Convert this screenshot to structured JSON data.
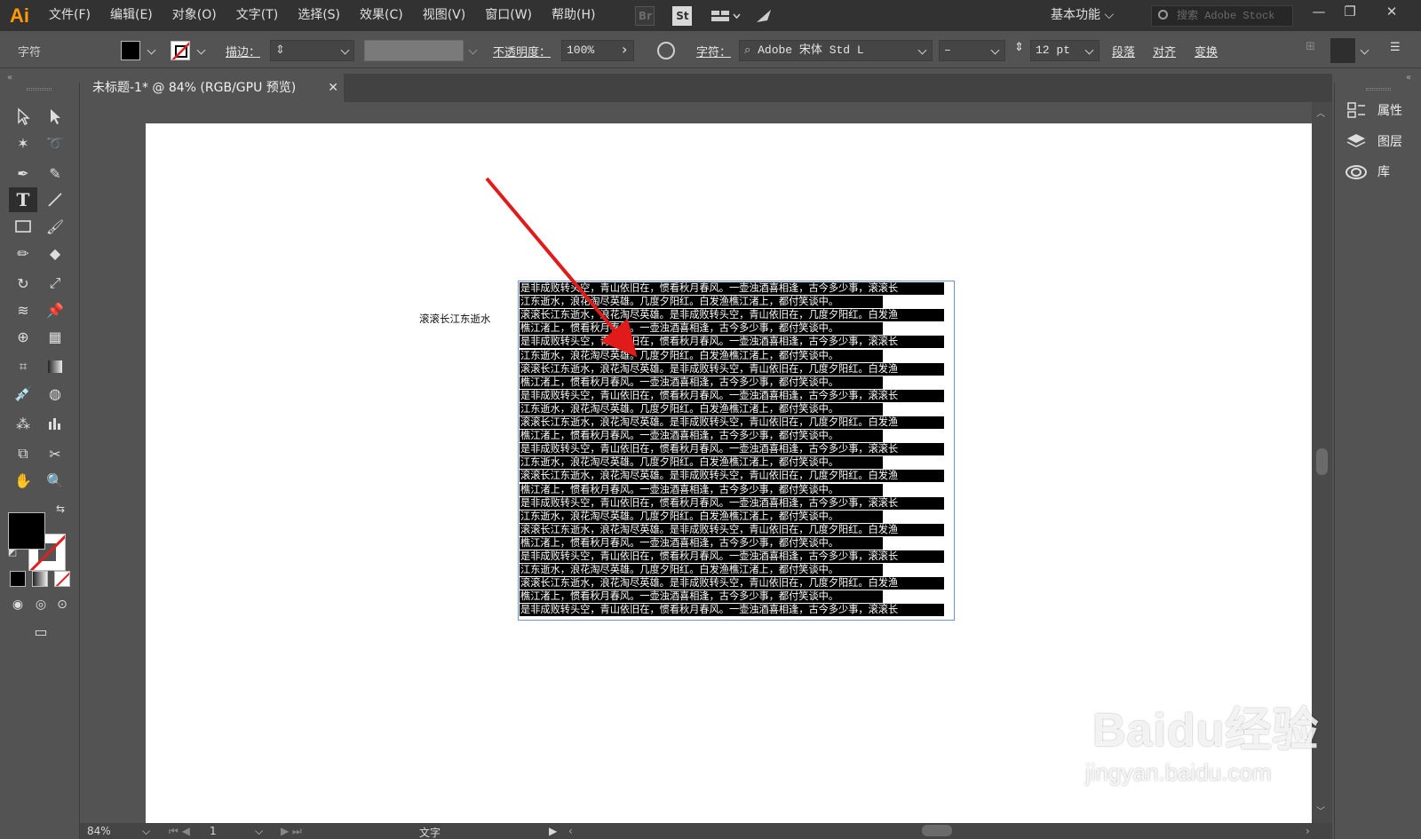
{
  "app": {
    "logo": "Ai"
  },
  "menu": [
    "文件(F)",
    "编辑(E)",
    "对象(O)",
    "文字(T)",
    "选择(S)",
    "效果(C)",
    "视图(V)",
    "窗口(W)",
    "帮助(H)"
  ],
  "menubar_icons": {
    "bridge": "Br",
    "stock": "St"
  },
  "workspace": "基本功能",
  "search": {
    "placeholder": "搜索 Adobe Stock"
  },
  "control": {
    "panel_name": "字符",
    "stroke_label": "描边：",
    "opacity_label": "不透明度：",
    "opacity_value": "100%",
    "char_label": "字符：",
    "font_family": "Adobe 宋体 Std L",
    "font_style": "–",
    "font_size": "12 pt",
    "paragraph": "段落",
    "align": "对齐",
    "transform": "变换"
  },
  "tab": {
    "title": "未标题-1* @ 84% (RGB/GPU 预览)",
    "close": "✕"
  },
  "canvas": {
    "point_text": "滚滚长江东逝水",
    "lines": [
      "是非成败转头空，青山依旧在，惯看秋月春风。一壶浊酒喜相逢，古今多少事，滚滚长",
      "江东逝水，浪花淘尽英雄。几度夕阳红。白发渔樵江渚上，都付笑谈中。",
      "滚滚长江东逝水，浪花淘尽英雄。是非成败转头空，青山依旧在，几度夕阳红。白发渔",
      "樵江渚上，惯看秋月春风。一壶浊酒喜相逢，古今多少事，都付笑谈中。",
      "是非成败转头空，青山依旧在，惯看秋月春风。一壶浊酒喜相逢，古今多少事，滚滚长",
      "江东逝水，浪花淘尽英雄。几度夕阳红。白发渔樵江渚上，都付笑谈中。",
      "滚滚长江东逝水，浪花淘尽英雄。是非成败转头空，青山依旧在，几度夕阳红。白发渔",
      "樵江渚上，惯看秋月春风。一壶浊酒喜相逢，古今多少事，都付笑谈中。",
      "是非成败转头空，青山依旧在，惯看秋月春风。一壶浊酒喜相逢，古今多少事，滚滚长",
      "江东逝水，浪花淘尽英雄。几度夕阳红。白发渔樵江渚上，都付笑谈中。",
      "滚滚长江东逝水，浪花淘尽英雄。是非成败转头空，青山依旧在，几度夕阳红。白发渔",
      "樵江渚上，惯看秋月春风。一壶浊酒喜相逢，古今多少事，都付笑谈中。",
      "是非成败转头空，青山依旧在，惯看秋月春风。一壶浊酒喜相逢，古今多少事，滚滚长",
      "江东逝水，浪花淘尽英雄。几度夕阳红。白发渔樵江渚上，都付笑谈中。",
      "滚滚长江东逝水，浪花淘尽英雄。是非成败转头空，青山依旧在，几度夕阳红。白发渔",
      "樵江渚上，惯看秋月春风。一壶浊酒喜相逢，古今多少事，都付笑谈中。",
      "是非成败转头空，青山依旧在，惯看秋月春风。一壶浊酒喜相逢，古今多少事，滚滚长",
      "江东逝水，浪花淘尽英雄。几度夕阳红。白发渔樵江渚上，都付笑谈中。",
      "滚滚长江东逝水，浪花淘尽英雄。是非成败转头空，青山依旧在，几度夕阳红。白发渔",
      "樵江渚上，惯看秋月春风。一壶浊酒喜相逢，古今多少事，都付笑谈中。",
      "是非成败转头空，青山依旧在，惯看秋月春风。一壶浊酒喜相逢，古今多少事，滚滚长",
      "江东逝水，浪花淘尽英雄。几度夕阳红。白发渔樵江渚上，都付笑谈中。",
      "滚滚长江东逝水，浪花淘尽英雄。是非成败转头空，青山依旧在，几度夕阳红。白发渔",
      "樵江渚上，惯看秋月春风。一壶浊酒喜相逢，古今多少事，都付笑谈中。",
      "是非成败转头空，青山依旧在，惯看秋月春风。一壶浊酒喜相逢，古今多少事，滚滚长"
    ]
  },
  "panel": {
    "items": [
      "属性",
      "图层",
      "库"
    ]
  },
  "status": {
    "zoom": "84%",
    "page": "1",
    "tool": "文字"
  },
  "watermark": {
    "brand": "Baidu经验",
    "url": "jingyan.baidu.com"
  },
  "colors": {
    "fill": "#000000",
    "stroke_none": "#e02020",
    "arrow": "#e11a1a",
    "selection": "#6b8fe6"
  }
}
